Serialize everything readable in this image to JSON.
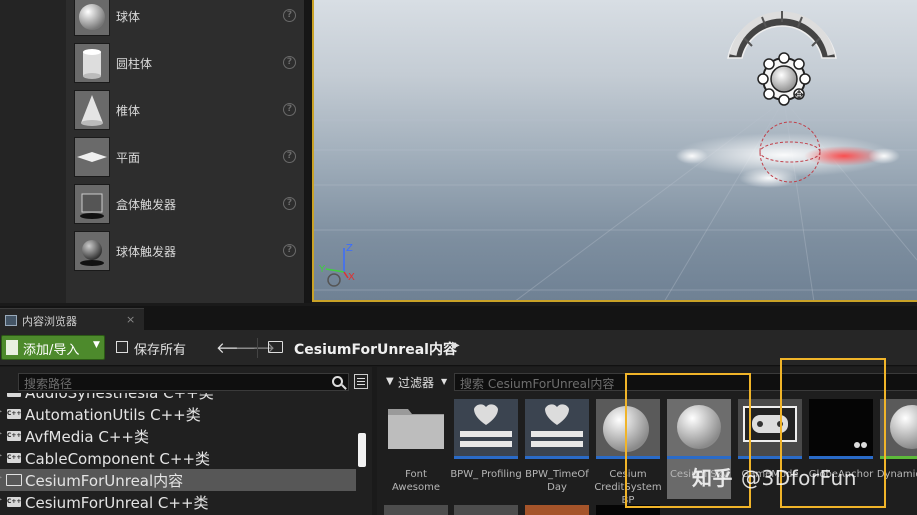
{
  "place_panel": {
    "items": [
      {
        "label": "球体",
        "icon": "sphere-icon"
      },
      {
        "label": "圆柱体",
        "icon": "cylinder-icon"
      },
      {
        "label": "椎体",
        "icon": "cone-icon"
      },
      {
        "label": "平面",
        "icon": "plane-icon"
      },
      {
        "label": "盒体触发器",
        "icon": "box-trigger-icon"
      },
      {
        "label": "球体触发器",
        "icon": "sphere-trigger-icon"
      }
    ],
    "help_glyph": "?"
  },
  "viewport": {
    "axis_labels": {
      "z": "Z",
      "y": "Y",
      "x": "X"
    }
  },
  "content_browser": {
    "tab_title": "内容浏览器",
    "tab_close": "×",
    "toolbar": {
      "add_import_label": "添加/导入",
      "save_all_label": "保存所有",
      "back_glyph": "🡐",
      "forward_glyph": "🡒",
      "breadcrumb": "CesiumForUnreal内容",
      "breadcrumb_arrow": "▶"
    },
    "sources": {
      "search_placeholder": "搜索路径",
      "tree": [
        {
          "label": "AudioSynesthesia C++类",
          "type": "cpp",
          "selected": false
        },
        {
          "label": "AutomationUtils C++类",
          "type": "cpp",
          "selected": false
        },
        {
          "label": "AvfMedia C++类",
          "type": "cpp",
          "selected": false
        },
        {
          "label": "CableComponent C++类",
          "type": "cpp",
          "selected": false
        },
        {
          "label": "CesiumForUnreal内容",
          "type": "folder",
          "selected": true
        },
        {
          "label": "CesiumForUnreal C++类",
          "type": "cpp",
          "selected": false
        }
      ],
      "cpp_badge": "C++"
    },
    "assets": {
      "filter_label": "过滤器",
      "search_placeholder": "搜索 CesiumForUnreal内容",
      "tiles": [
        {
          "name": "Font Awesome",
          "kind": "folder"
        },
        {
          "name": "BPW_ Profiling",
          "kind": "widget"
        },
        {
          "name": "BPW_TimeOf Day",
          "kind": "widget"
        },
        {
          "name": "Cesium CreditSystem BP",
          "kind": "sphere"
        },
        {
          "name": "Cesium Sky",
          "kind": "sphere"
        },
        {
          "name": "GameMode",
          "kind": "gamemode"
        },
        {
          "name": "GlobeAnchor",
          "kind": "dark"
        },
        {
          "name": "DynamicPawn",
          "kind": "sphere"
        }
      ]
    }
  },
  "watermark": {
    "logo": "知乎",
    "handle": "@3DforFun"
  },
  "colors": {
    "highlight": "#f0b429",
    "accent_green": "#4d8a2c",
    "asset_blue": "#2a6bc8"
  }
}
